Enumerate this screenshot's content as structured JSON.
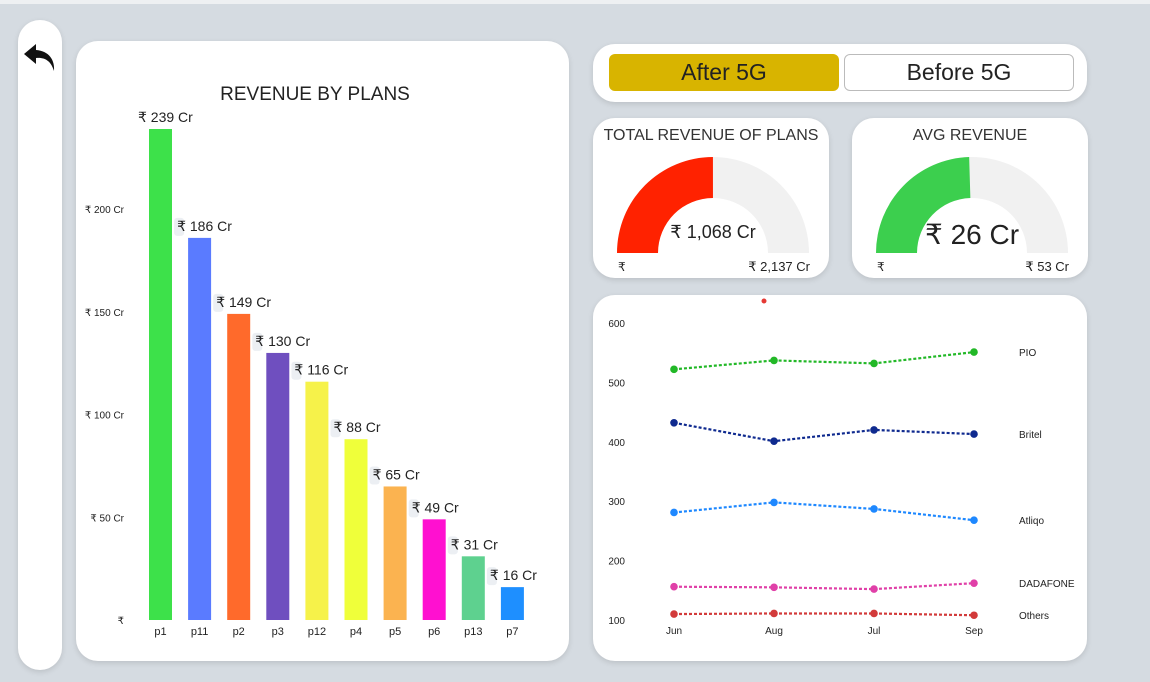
{
  "toggle": {
    "active_label": "After 5G",
    "inactive_label": "Before 5G"
  },
  "revenue_chart": {
    "chart_data": {
      "type": "bar",
      "title": "REVENUE BY PLANS",
      "categories": [
        "p1",
        "p11",
        "p2",
        "p3",
        "p12",
        "p4",
        "p5",
        "p6",
        "p13",
        "p7"
      ],
      "values": [
        239,
        186,
        149,
        130,
        116,
        88,
        65,
        49,
        31,
        16
      ],
      "data_labels": [
        "₹ 239 Cr",
        "₹ 186 Cr",
        "₹ 149 Cr",
        "₹ 130 Cr",
        "₹ 116 Cr",
        "₹ 88 Cr",
        "₹ 65 Cr",
        "₹ 49 Cr",
        "₹ 31 Cr",
        "₹ 16 Cr"
      ],
      "colors": [
        "#3de14a",
        "#5a7bff",
        "#ff6a2b",
        "#6f4fbf",
        "#f6f24a",
        "#efff3a",
        "#fbb350",
        "#ff10d0",
        "#5ed18f",
        "#1e8fff"
      ],
      "yticks": [
        0,
        50,
        100,
        150,
        200
      ],
      "ytick_labels": [
        "₹",
        "₹ 50 Cr",
        "₹ 100 Cr",
        "₹ 150 Cr",
        "₹ 200 Cr"
      ],
      "ylim": [
        0,
        239
      ]
    }
  },
  "gauge_total": {
    "title": "TOTAL REVENUE OF PLANS",
    "value_label": "₹ 1,068 Cr",
    "min_label": "₹",
    "max_label": "₹ 2,137 Cr",
    "value": 1068,
    "max": 2137,
    "color": "#ff2200"
  },
  "gauge_avg": {
    "title": "AVG REVENUE",
    "value_label": "₹ 26 Cr",
    "min_label": "₹",
    "max_label": "₹ 53 Cr",
    "value": 26,
    "max": 53,
    "color": "#3ccf4e"
  },
  "line_chart": {
    "chart_data": {
      "type": "line",
      "x": [
        "Jun",
        "Aug",
        "Jul",
        "Sep"
      ],
      "yticks": [
        100,
        200,
        300,
        400,
        500,
        600
      ],
      "ylim": [
        100,
        600
      ],
      "series": [
        {
          "name": "PIO",
          "values": [
            522,
            537,
            532,
            551
          ],
          "color": "#22b827"
        },
        {
          "name": "Britel",
          "values": [
            432,
            401,
            420,
            413
          ],
          "color": "#0f2a8f"
        },
        {
          "name": "Atliqo",
          "values": [
            281,
            298,
            287,
            268
          ],
          "color": "#1e88ff"
        },
        {
          "name": "DADAFONE",
          "values": [
            156,
            155,
            152,
            162
          ],
          "color": "#e040a8"
        },
        {
          "name": "Others",
          "values": [
            110,
            111,
            111,
            108
          ],
          "color": "#d23a3a"
        }
      ]
    }
  }
}
